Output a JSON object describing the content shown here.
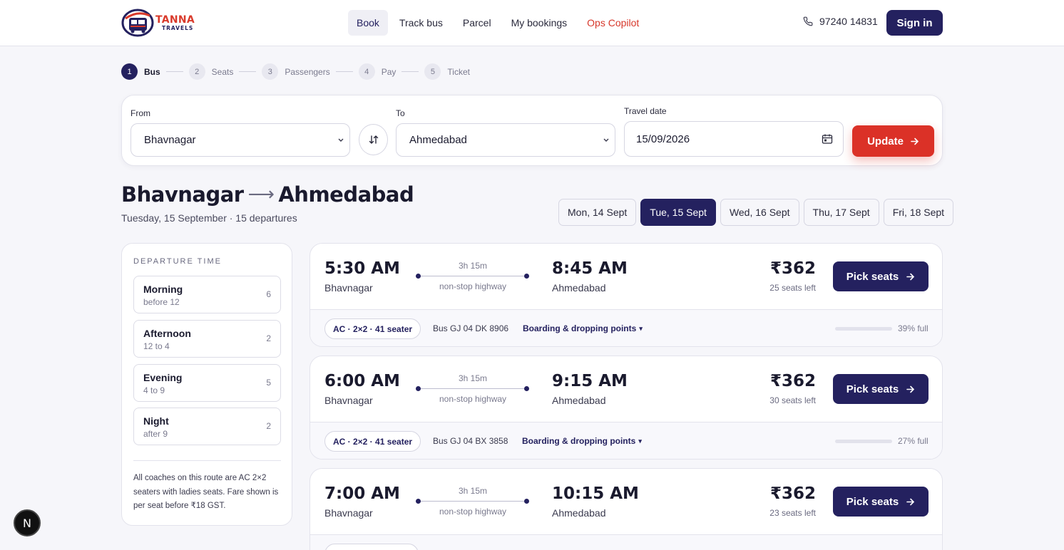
{
  "brand": {
    "line1": "TANNA",
    "line2": "TRAVELS",
    "mark_text": "TANNA"
  },
  "nav": [
    {
      "label": "Book",
      "active": true
    },
    {
      "label": "Track bus",
      "active": false
    },
    {
      "label": "Parcel",
      "active": false
    },
    {
      "label": "My bookings",
      "active": false
    },
    {
      "label": "Ops Copilot",
      "active": false
    }
  ],
  "contact": {
    "phone": "97240 14831",
    "icon": "phone-icon"
  },
  "header": {
    "signin_label": "Sign in"
  },
  "stepper": [
    {
      "num": "1",
      "label": "Bus",
      "active": true
    },
    {
      "num": "2",
      "label": "Seats",
      "active": false
    },
    {
      "num": "3",
      "label": "Passengers",
      "active": false
    },
    {
      "num": "4",
      "label": "Pay",
      "active": false
    },
    {
      "num": "5",
      "label": "Ticket",
      "active": false
    }
  ],
  "search": {
    "from_label": "From",
    "from_value": "Bhavnagar",
    "to_label": "To",
    "to_value": "Ahmedabad",
    "date_label": "Travel date",
    "date_value": "15/09/2026",
    "update_label": "Update"
  },
  "route": {
    "from": "Bhavnagar",
    "arrow": "⟶",
    "to": "Ahmedabad",
    "subtitle": "Tuesday, 15 September · 15 departures"
  },
  "date_tabs": [
    {
      "label": "Mon, 14 Sept",
      "active": false
    },
    {
      "label": "Tue, 15 Sept",
      "active": true
    },
    {
      "label": "Wed, 16 Sept",
      "active": false
    },
    {
      "label": "Thu, 17 Sept",
      "active": false
    },
    {
      "label": "Fri, 18 Sept",
      "active": false
    }
  ],
  "sidebar": {
    "heading": "DEPARTURE TIME",
    "slots": [
      {
        "name": "Morning",
        "hint": "before 12",
        "count": "6"
      },
      {
        "name": "Afternoon",
        "hint": "12 to 4",
        "count": "2"
      },
      {
        "name": "Evening",
        "hint": "4 to 9",
        "count": "5"
      },
      {
        "name": "Night",
        "hint": "after 9",
        "count": "2"
      }
    ],
    "note": "All coaches on this route are AC 2×2 seaters with ladies seats. Fare shown is per seat before ₹18 GST."
  },
  "trips": [
    {
      "dep_time": "5:30 AM",
      "dep_city": "Bhavnagar",
      "duration": "3h 15m",
      "via": "non-stop highway",
      "arr_time": "8:45 AM",
      "arr_city": "Ahmedabad",
      "price": "₹362",
      "seats_left": "25 seats left",
      "cta": "Pick seats",
      "coach": "AC · 2×2 · 41 seater",
      "bus_no": "Bus GJ 04 DK 8906",
      "boarding": "Boarding & dropping points",
      "fill_fraction": 0.39,
      "full_label": "39% full"
    },
    {
      "dep_time": "6:00 AM",
      "dep_city": "Bhavnagar",
      "duration": "3h 15m",
      "via": "non-stop highway",
      "arr_time": "9:15 AM",
      "arr_city": "Ahmedabad",
      "price": "₹362",
      "seats_left": "30 seats left",
      "cta": "Pick seats",
      "coach": "AC · 2×2 · 41 seater",
      "bus_no": "Bus GJ 04 BX 3858",
      "boarding": "Boarding & dropping points",
      "fill_fraction": 0.27,
      "full_label": "27% full"
    },
    {
      "dep_time": "7:00 AM",
      "dep_city": "Bhavnagar",
      "duration": "3h 15m",
      "via": "non-stop highway",
      "arr_time": "10:15 AM",
      "arr_city": "Ahmedabad",
      "price": "₹362",
      "seats_left": "23 seats left",
      "cta": "Pick seats",
      "coach": "",
      "bus_no": "",
      "boarding": "",
      "fill_fraction": 0,
      "full_label": ""
    }
  ],
  "fab": {
    "label": "N"
  },
  "colors": {
    "primary": "#24215f",
    "accent": "#db3127",
    "ops": "#d7372a",
    "bar_fill": "#3a35a8"
  }
}
